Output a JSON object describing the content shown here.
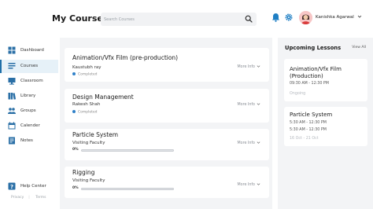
{
  "header": {
    "title": "My Courses",
    "search_placeholder": "Search Courses",
    "user_name": "Kanishka Agarwal"
  },
  "sidebar": {
    "items": [
      {
        "label": "Dashboard",
        "icon": "dashboard-icon",
        "active": false
      },
      {
        "label": "Courses",
        "icon": "courses-icon",
        "active": true
      },
      {
        "label": "Classroom",
        "icon": "classroom-icon",
        "active": false
      },
      {
        "label": "Library",
        "icon": "library-icon",
        "active": false
      },
      {
        "label": "Groups",
        "icon": "groups-icon",
        "active": false
      },
      {
        "label": "Calender",
        "icon": "calendar-icon",
        "active": false
      },
      {
        "label": "Notes",
        "icon": "notes-icon",
        "active": false
      }
    ],
    "help_label": "Help Center",
    "footer": {
      "privacy": "Privacy",
      "terms": "Terms"
    }
  },
  "courses": [
    {
      "title": "Animation/Vfx Film (pre-production)",
      "author": "Kaustubh ray",
      "status": "Completed",
      "more": "More Info"
    },
    {
      "title": "Design Management",
      "author": "Rakesh Shah",
      "status": "Completed",
      "more": "More Info"
    },
    {
      "title": "Particle System",
      "author": "Visiting Faculty",
      "progress_label": "0%",
      "progress": 0,
      "more": "More Info"
    },
    {
      "title": "Rigging",
      "author": "Visiting Faculty",
      "progress_label": "0%",
      "progress": 0,
      "more": "More Info"
    }
  ],
  "upcoming": {
    "title": "Upcoming Lessons",
    "view_all": "View All",
    "lessons": [
      {
        "title": "Animation/Vfx Film (Production)",
        "time": "09:30 AM - 12:30 PM",
        "note": "Ongoing"
      },
      {
        "title": "Particle System",
        "time_1": "5:30 AM - 12:30 PM",
        "time_2": "5:30 AM - 12:30 PM",
        "date": "16 Oct - 21 Oct"
      }
    ]
  },
  "colors": {
    "accent": "#1f6fa8",
    "active_bg": "#e6f1f8",
    "progress": "#2f80c8",
    "panel_bg": "#f3f4f6"
  }
}
